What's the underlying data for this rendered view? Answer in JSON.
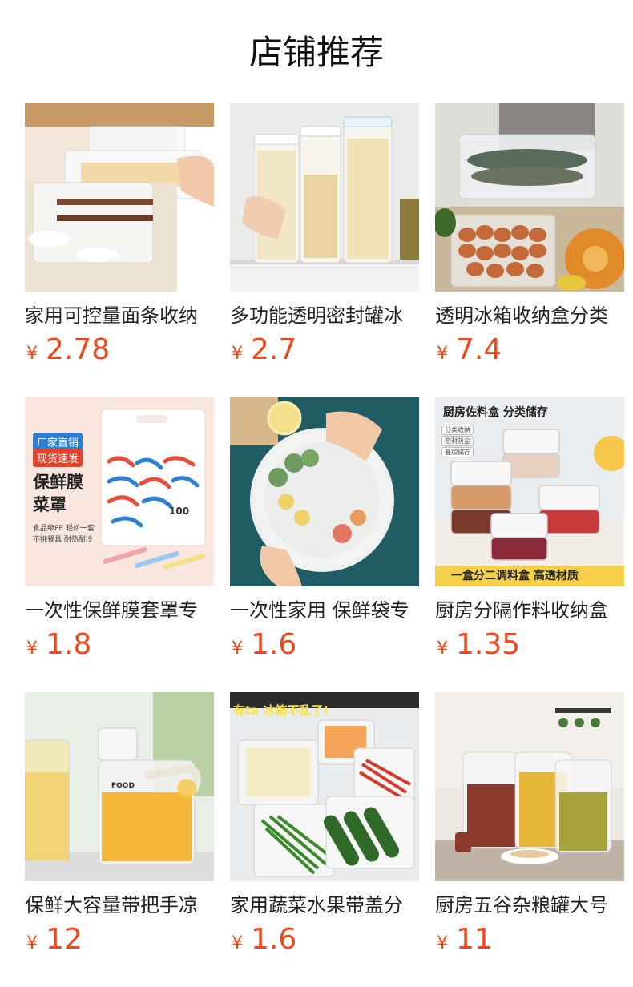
{
  "header": {
    "title": "店铺推荐"
  },
  "currency": "¥",
  "products": [
    {
      "title": "家用可控量面条收纳",
      "price": "2.78"
    },
    {
      "title": "多功能透明密封罐冰",
      "price": "2.7"
    },
    {
      "title": "透明冰箱收纳盒分类",
      "price": "7.4"
    },
    {
      "title": "一次性保鲜膜套罩专",
      "price": "1.8"
    },
    {
      "title": "一次性家用 保鲜袋专",
      "price": "1.6"
    },
    {
      "title": "厨房分隔作料收纳盒",
      "price": "1.35"
    },
    {
      "title": "保鲜大容量带把手凉",
      "price": "12"
    },
    {
      "title": "家用蔬菜水果带盖分",
      "price": "1.6"
    },
    {
      "title": "厨房五谷杂粮罐大号",
      "price": "11"
    }
  ],
  "image_text": {
    "wrap_badge_1": "厂家直销",
    "wrap_badge_2": "现货速发",
    "wrap_title_1": "保鲜膜",
    "wrap_title_2": "菜罩",
    "wrap_note_1": "食品级PE 轻松一套",
    "wrap_note_2": "不挑餐具 耐热耐冷",
    "wrap_pack": "100",
    "spice_heading": "厨房佐料盒 分类储存",
    "spice_tag_1": "分类收纳",
    "spice_tag_2": "密封防尘",
    "spice_tag_3": "叠加储存",
    "spice_footer": "一盒分二调料盒 高透材质",
    "fridge_banner": "有ta 冰箱不乱了!",
    "jug_label": "FOOD"
  },
  "colors": {
    "price": "#f0481c",
    "title": "#222222",
    "header": "#111111"
  }
}
